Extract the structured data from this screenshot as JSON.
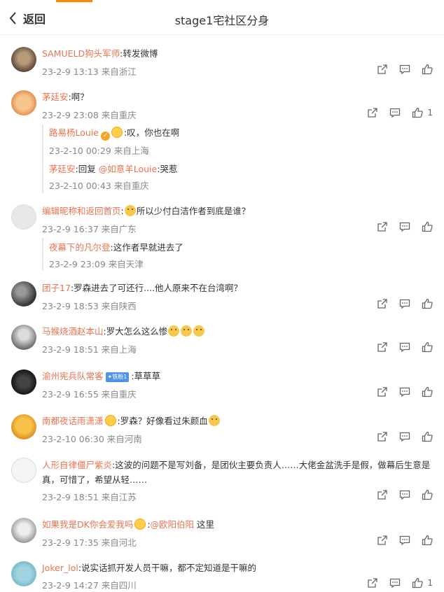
{
  "header": {
    "back_label": "返回",
    "title": "stage1宅社区分身"
  },
  "comments": [
    {
      "user": "SAMUELD狗头军师",
      "text": ":转发微博",
      "meta": "23-2-9 13:13 来自浙江"
    },
    {
      "user": "茅廷安",
      "text": ":啊？",
      "meta": "23-2-9 23:08 来自重庆",
      "likes": "1",
      "replies": [
        {
          "user": "路易杨Louie",
          "text": ":叹，你也在啊",
          "meta": "23-2-10 00:29 来自上海"
        },
        {
          "user": "茅廷安",
          "text_pre": ":回复 ",
          "mention": "@如意羊Louie",
          "text": ":哭惹",
          "meta": "23-2-10 00:43 来自重庆"
        }
      ]
    },
    {
      "user": "编辑昵称和返回首页",
      "text": "所以少付白洁作者到底是谁？",
      "meta": "23-2-9 16:37 来自广东",
      "replies": [
        {
          "user": "夜幕下的凡尔登",
          "text": ":这作者早就进去了",
          "meta": "23-2-9 23:09 来自天津"
        }
      ]
    },
    {
      "user": "团子17",
      "text": ":罗森进去了可还行....他人原来不在台湾啊？",
      "meta": "23-2-9 18:53 来自陕西"
    },
    {
      "user": "马猴烧酒赵本山",
      "text": ":罗大怎么这么惨",
      "meta": "23-2-9 18:51 来自上海"
    },
    {
      "user": "渝州宪兵队常客",
      "fan_badge": "✦铁粉1",
      "text": ":草草草",
      "meta": "23-2-9 16:55 来自重庆"
    },
    {
      "user": "南都夜话雨潇潇",
      "text": ":罗森？好像看过朱颜血",
      "meta": "23-2-10 06:30 来自河南"
    },
    {
      "user": "人形自律僵尸紫炎",
      "text": ":这波的问题不是写刘备，是团伙主要负责人……大佬金盆洗手是假，做幕后生意是真，可惜了，希望从轻……",
      "meta": "23-2-9 18:51 来自江苏"
    },
    {
      "user": "如果我是DK你会爱我吗",
      "text_pre": ":",
      "mention": "@欧阳伯阳",
      "text": " 这里",
      "meta": "23-2-9 17:35 来自河北"
    },
    {
      "user": "Joker_lol",
      "text": ":说实话抓开发人员干嘛，都不定知道是干嘛的",
      "meta": "23-2-9 14:27 来自四川",
      "likes": "1"
    }
  ],
  "colors": {
    "username": "#eb7350",
    "accent": "#ff8200",
    "meta": "#888888"
  },
  "icons": [
    "back-chevron-icon",
    "share-icon",
    "comment-icon",
    "like-icon"
  ]
}
